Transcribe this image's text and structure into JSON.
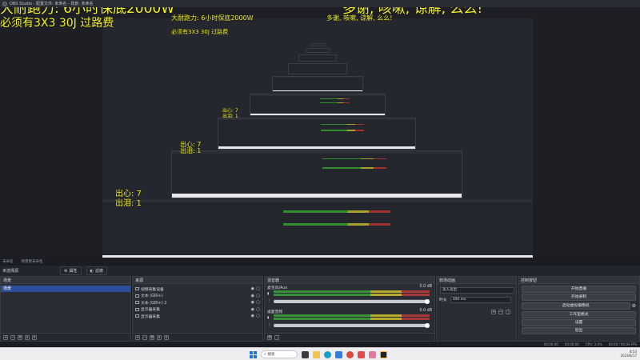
{
  "window": {
    "title": "OBS Studio - 配置文件: 未命名 - 场景: 未命名"
  },
  "overlay": {
    "left_line1": "大耐跑力: 6小时保底2000W",
    "left_line2": "必须有3X3 30J 过路费",
    "right_line1": "多谢, 咳嗽, 谅解, 么么!",
    "stat_out": "出心: 7",
    "stat_in": "出泪: 1"
  },
  "scene_status": {
    "left": "未命名",
    "right": "场景暂未命名"
  },
  "modebar": {
    "label": "未选择源",
    "properties": "属性",
    "filters": "滤镜"
  },
  "docks": {
    "scenes": {
      "title": "场景",
      "items": [
        {
          "label": "场景"
        }
      ]
    },
    "sources": {
      "title": "来源",
      "items": [
        {
          "label": "视频采集设备"
        },
        {
          "label": "文本 (GDI+)"
        },
        {
          "label": "文本 (GDI+) 2"
        },
        {
          "label": "显示器采集"
        },
        {
          "label": "显示器采集"
        }
      ]
    },
    "mixer": {
      "title": "混音器",
      "channels": [
        {
          "name": "麦克风/Aux",
          "db": "0.0 dB"
        },
        {
          "name": "桌面音频",
          "db": "0.0 dB"
        }
      ]
    },
    "transitions": {
      "title": "转场动画",
      "type_value": "淡入淡出",
      "duration_label": "时长",
      "duration_value": "300 ms"
    },
    "controls": {
      "title": "控制按钮",
      "buttons": [
        "开始直播",
        "开始录制",
        "启动虚拟摄像机",
        "工作室模式",
        "设置",
        "退出"
      ]
    }
  },
  "statusbar": {
    "live": "00:00:00",
    "rec": "00:00:00",
    "cpu": "CPU: 3.4%",
    "fps": "60.00 / 60.00 FPS"
  },
  "taskbar": {
    "search_placeholder": "搜索",
    "time": "8:53",
    "date": "2023/6/17"
  },
  "colors": {
    "overlay_text": "#f4f227",
    "scene_selected": "#2c4f9c",
    "meter_green": "#3a8f3a",
    "meter_yellow": "#b4ab2d",
    "meter_red": "#a63a3a"
  }
}
